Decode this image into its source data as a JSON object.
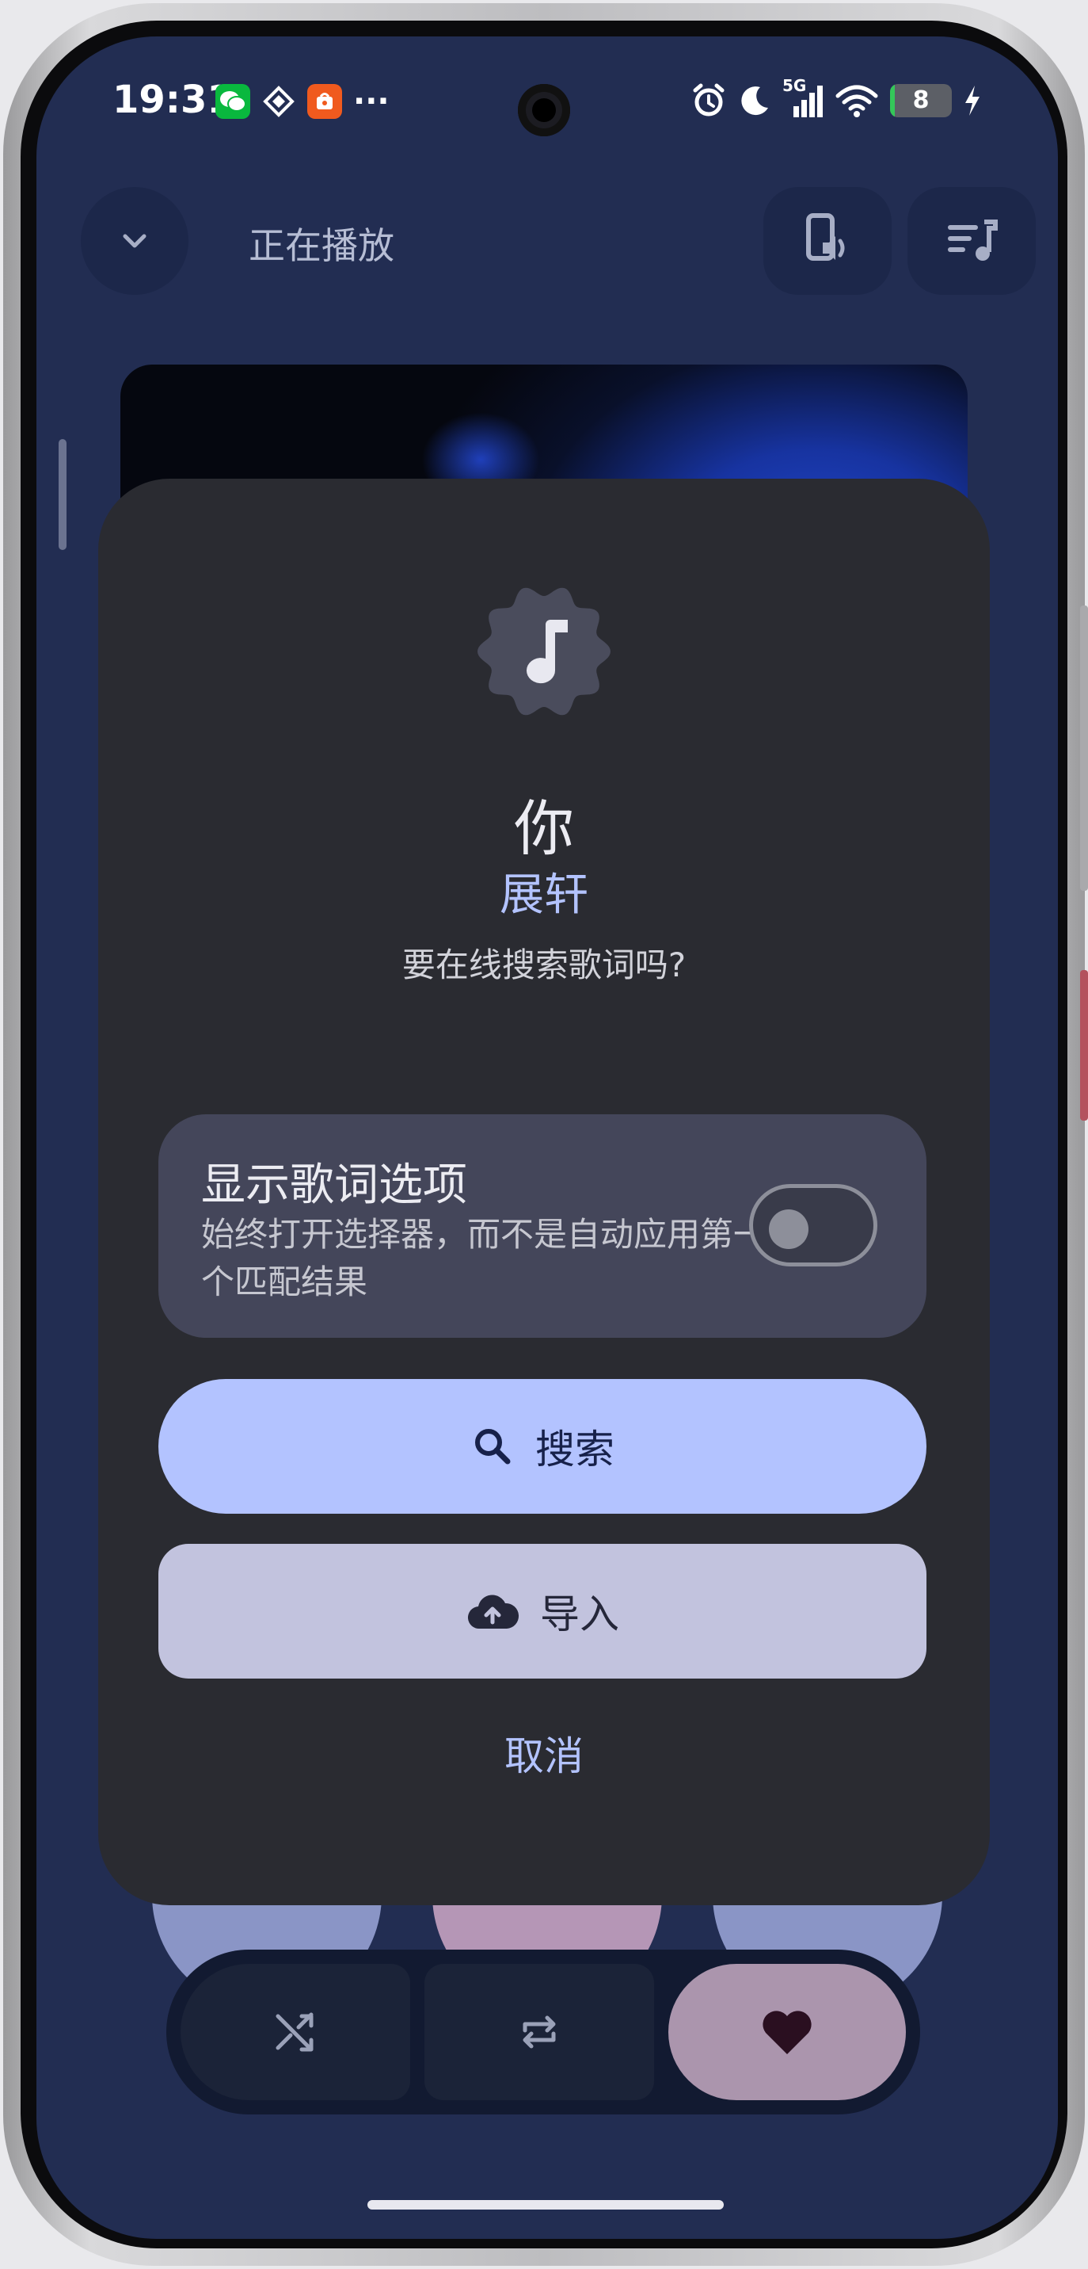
{
  "status_bar": {
    "time": "19:31",
    "network": "5G",
    "battery_level": "8",
    "battery_fraction": 0.08
  },
  "header": {
    "title": "正在播放"
  },
  "dialog": {
    "song_title": "你",
    "artist": "展轩",
    "question": "要在线搜索歌词吗?",
    "option": {
      "title": "显示歌词选项",
      "description": "始终打开选择器，而不是自动应用第一个匹配结果",
      "enabled": false
    },
    "search_label": "搜索",
    "import_label": "导入",
    "cancel_label": "取消"
  },
  "colors": {
    "screen_background": "#222d52",
    "dialog_background": "#2a2b31",
    "accent": "#b3c3ff",
    "secondary_button": "#c2c3de",
    "favorite_button": "#ab95ad"
  },
  "icons": {
    "back": "chevron-down-icon",
    "device_output": "phone-speaker-icon",
    "queue": "queue-music-icon",
    "dialog": "music-note-badge-icon",
    "search": "search-icon",
    "import": "cloud-upload-icon",
    "shuffle": "shuffle-icon",
    "repeat": "repeat-icon",
    "favorite": "heart-icon"
  }
}
